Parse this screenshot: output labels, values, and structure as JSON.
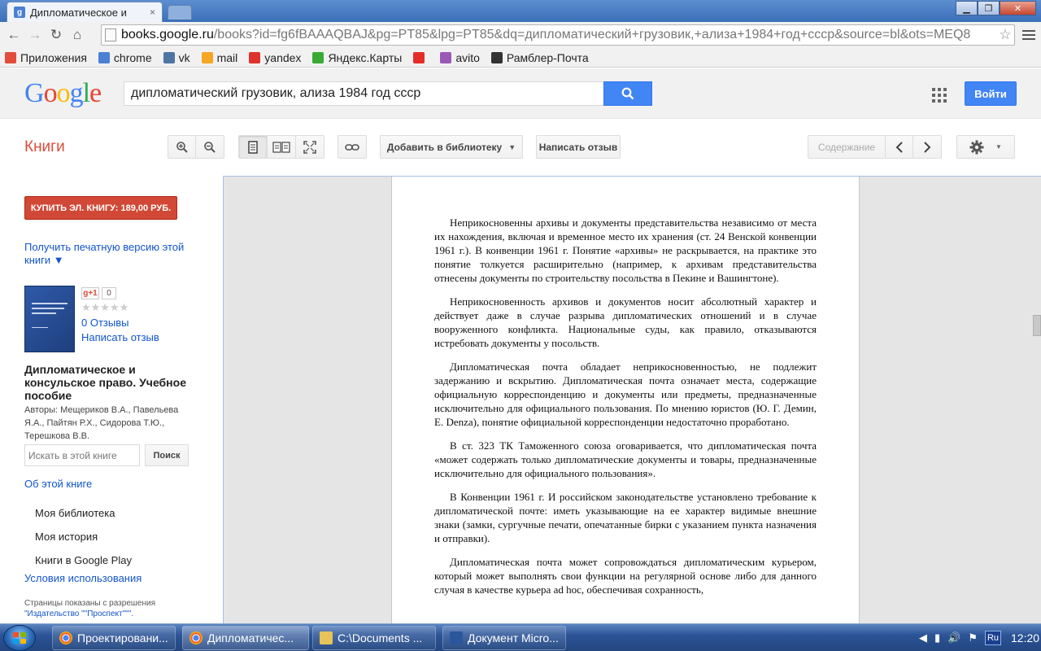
{
  "browser": {
    "tab_title": "Дипломатическое и",
    "tab_close": "×",
    "window_buttons": {
      "minimize": "▁",
      "maximize": "❐",
      "close": "✕"
    },
    "url_host": "books.google.ru",
    "url_rest": "/books?id=fg6fBAAAQBAJ&pg=PT85&lpg=PT85&dq=дипломатический+грузовик,+ализа+1984+год+ссср&source=bl&ots=MEQ8",
    "bookmarks": [
      {
        "label": "Приложения",
        "icon": "apps-grid-icon",
        "color": "#e24c3c"
      },
      {
        "label": "chrome",
        "icon": "google-icon",
        "color": "#4a7fd4"
      },
      {
        "label": "vk",
        "icon": "vk-icon",
        "color": "#4c75a3"
      },
      {
        "label": "mail",
        "icon": "mail-icon",
        "color": "#f5a623"
      },
      {
        "label": "yandex",
        "icon": "yandex-icon",
        "color": "#e0322c"
      },
      {
        "label": "Яндекс.Карты",
        "icon": "yandex-maps-icon",
        "color": "#3aaa35"
      },
      {
        "label": "",
        "icon": "youtube-icon",
        "color": "#e52d27"
      },
      {
        "label": "avito",
        "icon": "avito-icon",
        "color": "#9b59b6"
      },
      {
        "label": "Рамблер-Почта",
        "icon": "rambler-mail-icon",
        "color": "#333333"
      }
    ]
  },
  "google": {
    "logo": [
      "G",
      "o",
      "o",
      "g",
      "l",
      "e"
    ],
    "logo_colors": [
      "#4285f4",
      "#ea4335",
      "#fbbc05",
      "#4285f4",
      "#34a853",
      "#ea4335"
    ],
    "search_query": "дипломатический грузовик, ализа 1984 год ссср",
    "signin_label": "Войти"
  },
  "toolbar": {
    "section_title": "Книги",
    "add_to_library": "Добавить в библиотеку",
    "write_review": "Написать отзыв",
    "contents": "Содержание"
  },
  "sidebar": {
    "buy_button": "КУПИТЬ ЭЛ. КНИГУ: 189,00 РУБ.",
    "print_version": "Получить печатную версию этой книги ▼",
    "gplus_label": "g+1",
    "gplus_count": "0",
    "stars": "★★★★★",
    "reviews": "0 Отзывы",
    "write_review": "Написать отзыв",
    "book_title": "Дипломатическое и консульское право. Учебное пособие",
    "authors": "Авторы: Мещериков В.А., Павельева Я.А., Пайтян Р.Х., Сидорова Т.Ю., Терешкова В.В.",
    "search_placeholder": "Искать в этой книге",
    "search_button": "Поиск",
    "about_book": "Об этой книге",
    "nav": [
      "Моя библиотека",
      "Моя история",
      "Книги в Google Play"
    ],
    "terms": "Условия использования",
    "pages_shown_prefix": "Страницы показаны с разрешения",
    "publisher": "\"Издательство \"\"Проспект\"\"\"."
  },
  "page_text": [
    "Неприкосновенны архивы и документы представительства независимо от места их нахождения, включая и временное место их хранения (ст. 24 Венской конвенции 1961 г.). В конвенции 1961 г. Понятие «архивы» не раскрывается, на практике это понятие толкуется расширительно (например, к архивам представительства отнесены документы по строительству посольства в Пекине и Вашингтоне).",
    "Неприкосновенность архивов и документов носит абсолютный характер и действует даже в случае разрыва дипломатических отношений и в случае вооруженного конфликта. Национальные суды, как правило, отказываются истребовать документы у посольств.",
    "Дипломатическая почта обладает неприкосновенностью, не подлежит задержанию и вскрытию. Дипломатическая почта означает места, содержащие официальную корреспонденцию и документы или предметы, предназначенные исключительно для официального пользования. По мнению юристов (Ю. Г. Демин, Е. Denza), понятие официальной корреспонденции недостаточно проработано.",
    "В ст. 323 ТК Таможенного союза оговаривается, что дипломатическая почта «может содержать только дипломатические документы и товары, предназначенные исключительно для официального пользования».",
    "В Конвенции 1961 г. И российском законодательстве установлено требование к дипломатической почте: иметь указывающие на ее характер видимые внешние знаки (замки, сургучные печати, опечатанные бирки с указанием пункта назначения и отправки).",
    "Дипломатическая почта может сопровождаться дипломатическим курьером, который может выполнять свои функции на регулярной основе либо для данного случая в качестве курьера ad hoc, обеспечивая сохранность,"
  ],
  "taskbar": {
    "tasks": [
      {
        "label": "Проектировани...",
        "icon": "chrome-icon"
      },
      {
        "label": "Дипломатичес...",
        "icon": "chrome-icon"
      },
      {
        "label": "C:\\Documents ...",
        "icon": "folder-icon"
      },
      {
        "label": "Документ Micro...",
        "icon": "word-icon"
      }
    ],
    "lang": "Ru",
    "clock": "12:20"
  }
}
